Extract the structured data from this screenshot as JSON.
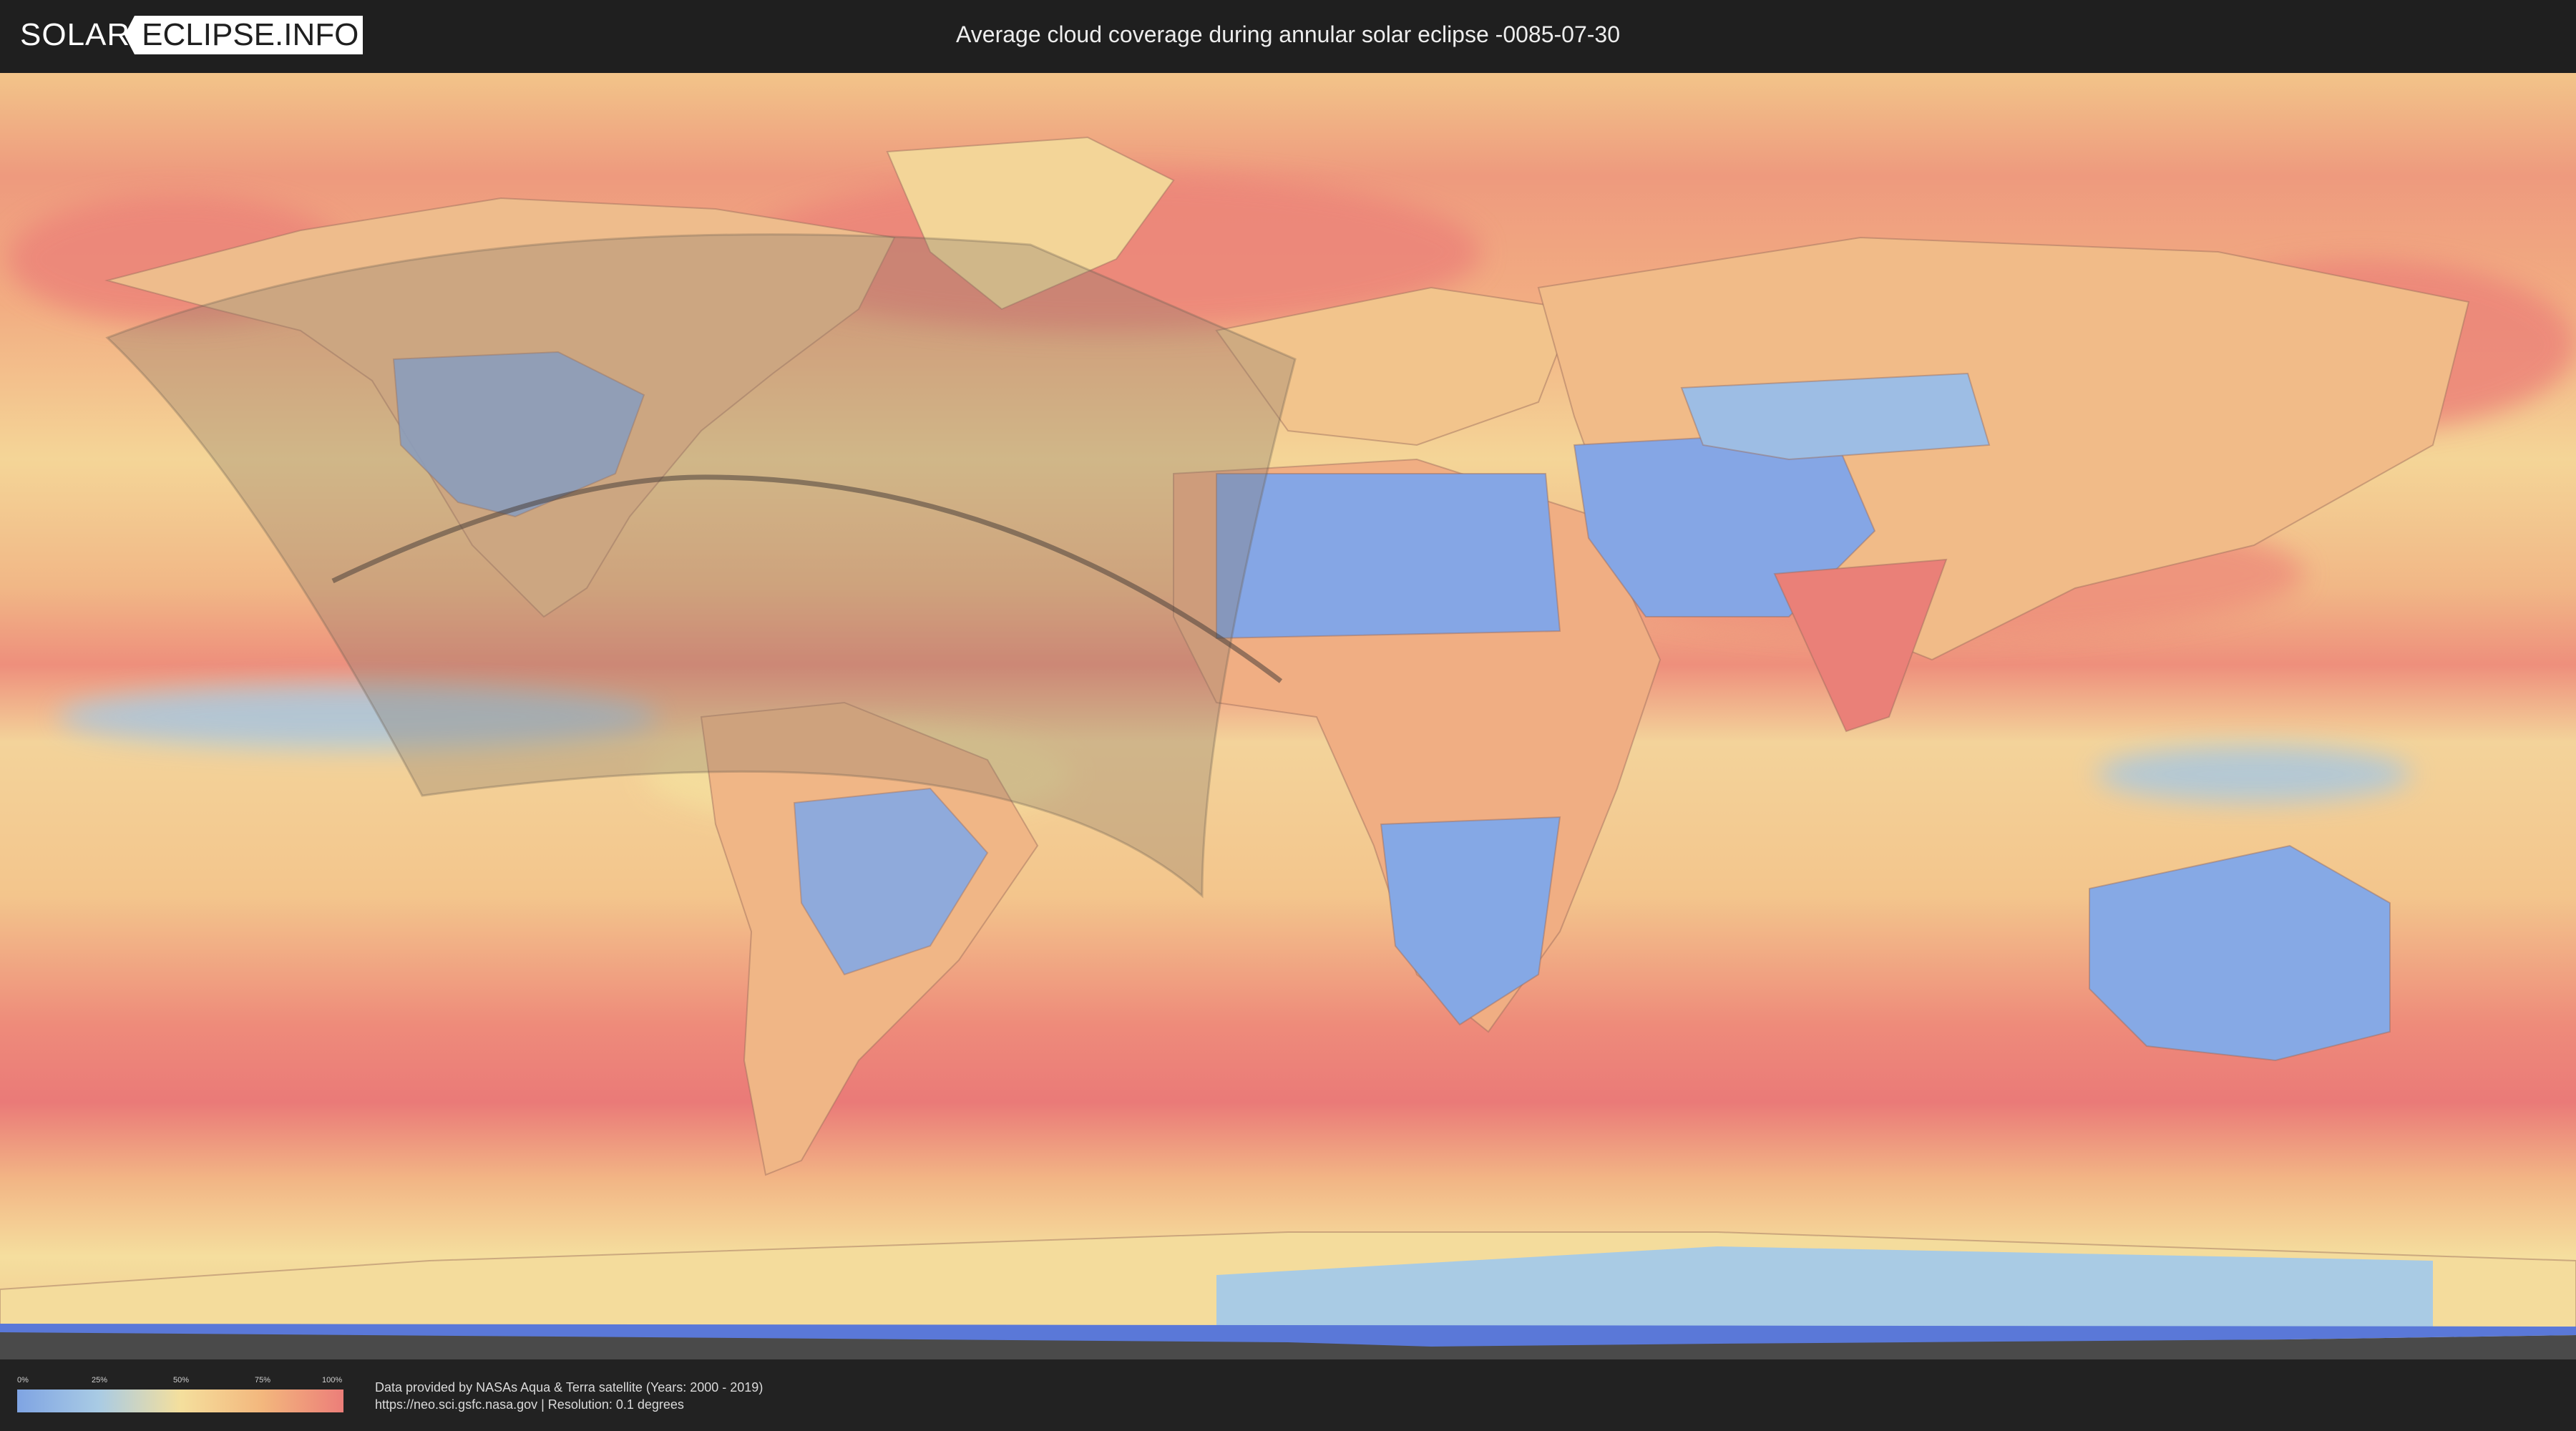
{
  "header": {
    "logo_solar": "SOLAR",
    "logo_eclipse": "ECLIPSE.INFO",
    "title": "Average cloud coverage during annular solar eclipse -0085-07-30"
  },
  "legend": {
    "ticks": [
      "0%",
      "25%",
      "50%",
      "75%",
      "100%"
    ],
    "colors": [
      "#7fa4e3",
      "#a9cbe4",
      "#f4df9d",
      "#f3b77d",
      "#ec7e79"
    ]
  },
  "footer": {
    "credit_line1": "Data provided by NASAs Aqua & Terra satellite (Years: 2000 - 2019)",
    "credit_line2": "https://neo.sci.gsfc.nasa.gov | Resolution: 0.1 degrees"
  }
}
